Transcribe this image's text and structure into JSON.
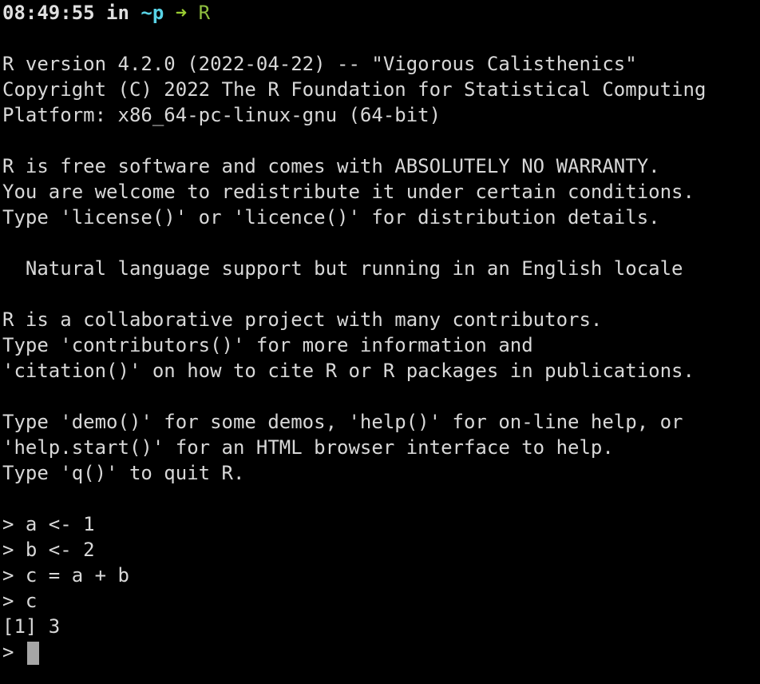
{
  "shell_prompt": {
    "time": "08:49:55",
    "in_word": "in",
    "cwd": "~p",
    "arrow": "➜",
    "command": "R"
  },
  "banner": [
    "R version 4.2.0 (2022-04-22) -- \"Vigorous Calisthenics\"",
    "Copyright (C) 2022 The R Foundation for Statistical Computing",
    "Platform: x86_64-pc-linux-gnu (64-bit)",
    "R is free software and comes with ABSOLUTELY NO WARRANTY.",
    "You are welcome to redistribute it under certain conditions.",
    "Type 'license()' or 'licence()' for distribution details.",
    "  Natural language support but running in an English locale",
    "R is a collaborative project with many contributors.",
    "Type 'contributors()' for more information and",
    "'citation()' on how to cite R or R packages in publications.",
    "Type 'demo()' for some demos, 'help()' for on-line help, or",
    "'help.start()' for an HTML browser interface to help.",
    "Type 'q()' to quit R."
  ],
  "session": [
    "> a <- 1",
    "> b <- 2",
    "> c = a + b",
    "> c",
    "[1] 3"
  ],
  "input_prompt": "> ",
  "colors": {
    "background": "#000000",
    "foreground": "#d8d8d8",
    "cwd": "#58d3e6",
    "command": "#8fbf3f",
    "cursor": "#a6a6a6"
  }
}
